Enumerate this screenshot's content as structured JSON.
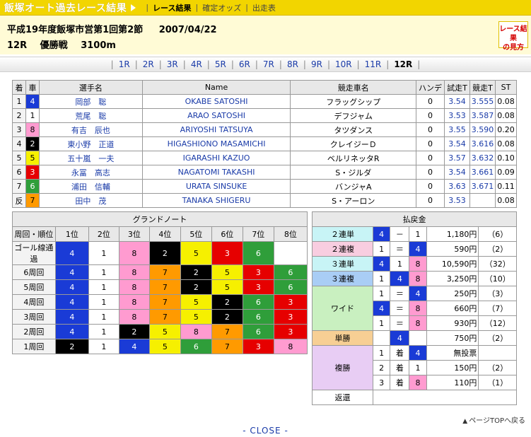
{
  "header": {
    "site_title": "飯塚オート過去レース結果",
    "nav": [
      {
        "label": "レース結果",
        "active": true
      },
      {
        "label": "確定オッズ",
        "active": false
      },
      {
        "label": "出走表",
        "active": false
      }
    ],
    "arrow_icon": "triangle-right-icon",
    "bar_color": "#f2d500"
  },
  "race_info": {
    "meeting": "平成19年度飯塚市営第1回第2節",
    "date": "2007/04/22",
    "race_no": "12R",
    "race_name": "優勝戦",
    "distance": "3100m",
    "guide_line1": "レース結果",
    "guide_line2": "の見方"
  },
  "race_tabs": {
    "items": [
      "1R",
      "2R",
      "3R",
      "4R",
      "5R",
      "6R",
      "7R",
      "8R",
      "9R",
      "10R",
      "11R",
      "12R"
    ],
    "current": "12R"
  },
  "results": {
    "headers": [
      "着",
      "車",
      "選手名",
      "Name",
      "競走車名",
      "ハンデ",
      "試走T",
      "競走T",
      "ST"
    ],
    "rows": [
      {
        "rank": "1",
        "car": "4",
        "name": "岡部　聡",
        "roman": "OKABE SATOSHI",
        "machine": "フラッグシップ",
        "handicap": "0",
        "trial": "3.54",
        "race_time": "3.555",
        "st": "0.08"
      },
      {
        "rank": "2",
        "car": "1",
        "name": "荒尾　聡",
        "roman": "ARAO SATOSHI",
        "machine": "デフジャム",
        "handicap": "0",
        "trial": "3.53",
        "race_time": "3.587",
        "st": "0.08"
      },
      {
        "rank": "3",
        "car": "8",
        "name": "有吉　辰也",
        "roman": "ARIYOSHI TATSUYA",
        "machine": "タツダンス",
        "handicap": "0",
        "trial": "3.55",
        "race_time": "3.590",
        "st": "0.20"
      },
      {
        "rank": "4",
        "car": "2",
        "name": "東小野　正道",
        "roman": "HIGASHIONO MASAMICHI",
        "machine": "クレイジーＤ",
        "handicap": "0",
        "trial": "3.54",
        "race_time": "3.616",
        "st": "0.08"
      },
      {
        "rank": "5",
        "car": "5",
        "name": "五十嵐　一夫",
        "roman": "IGARASHI KAZUO",
        "machine": "ベルリネッタR",
        "handicap": "0",
        "trial": "3.57",
        "race_time": "3.632",
        "st": "0.10"
      },
      {
        "rank": "6",
        "car": "3",
        "name": "永冨　高志",
        "roman": "NAGATOMI TAKASHI",
        "machine": "S・ジルダ",
        "handicap": "0",
        "trial": "3.54",
        "race_time": "3.661",
        "st": "0.09"
      },
      {
        "rank": "7",
        "car": "6",
        "name": "浦田　信輔",
        "roman": "URATA SINSUKE",
        "machine": "バンジャA",
        "handicap": "0",
        "trial": "3.63",
        "race_time": "3.671",
        "st": "0.11"
      },
      {
        "rank": "反",
        "car": "7",
        "name": "田中　茂",
        "roman": "TANAKA SHIGERU",
        "machine": "S・アーロン",
        "handicap": "0",
        "trial": "3.53",
        "race_time": "",
        "st": "0.08"
      }
    ]
  },
  "grand_note": {
    "title": "グランドノート",
    "headers": [
      "周回・順位",
      "1位",
      "2位",
      "3位",
      "4位",
      "5位",
      "6位",
      "7位",
      "8位"
    ],
    "rows": [
      {
        "lap": "ゴール線通過",
        "cars": [
          "4",
          "1",
          "8",
          "2",
          "5",
          "3",
          "6",
          ""
        ]
      },
      {
        "lap": "6周回",
        "cars": [
          "4",
          "1",
          "8",
          "7",
          "2",
          "5",
          "3",
          "6"
        ]
      },
      {
        "lap": "5周回",
        "cars": [
          "4",
          "1",
          "8",
          "7",
          "2",
          "5",
          "3",
          "6"
        ]
      },
      {
        "lap": "4周回",
        "cars": [
          "4",
          "1",
          "8",
          "7",
          "5",
          "2",
          "6",
          "3"
        ]
      },
      {
        "lap": "3周回",
        "cars": [
          "4",
          "1",
          "8",
          "7",
          "5",
          "2",
          "6",
          "3"
        ]
      },
      {
        "lap": "2周回",
        "cars": [
          "4",
          "1",
          "2",
          "5",
          "8",
          "7",
          "6",
          "3"
        ]
      },
      {
        "lap": "1周回",
        "cars": [
          "2",
          "1",
          "4",
          "5",
          "6",
          "7",
          "3",
          "8"
        ]
      }
    ]
  },
  "payouts": {
    "title": "払戻金",
    "rank_suffix": "着",
    "dash": "－",
    "equals": "＝",
    "rows": {
      "nirentan": {
        "label": "２連単",
        "c1": "4",
        "s1": "－",
        "c2": "1",
        "amount": "1,180円",
        "pop": "（6）"
      },
      "nirenfuku": {
        "label": "２連複",
        "c1": "1",
        "s1": "＝",
        "c2": "4",
        "amount": "590円",
        "pop": "（2）"
      },
      "sanrentan": {
        "label": "３連単",
        "c1": "4",
        "s1": "1",
        "c2": "8",
        "amount": "10,590円",
        "pop": "（32）"
      },
      "sanrenfuku": {
        "label": "３連複",
        "c1": "1",
        "s1": "4",
        "c2": "8",
        "amount": "3,250円",
        "pop": "（10）"
      },
      "wide_label": "ワイド",
      "wide": [
        {
          "c1": "1",
          "s1": "＝",
          "c2": "4",
          "amount": "250円",
          "pop": "（3）"
        },
        {
          "c1": "4",
          "s1": "＝",
          "c2": "8",
          "amount": "660円",
          "pop": "（7）"
        },
        {
          "c1": "1",
          "s1": "＝",
          "c2": "8",
          "amount": "930円",
          "pop": "（12）"
        }
      ],
      "tansho": {
        "label": "単勝",
        "car": "4",
        "amount": "750円",
        "pop": "（2）"
      },
      "fukusho_label": "複勝",
      "fukusho": [
        {
          "pos": "1",
          "car": "4",
          "amount": "無投票",
          "pop": ""
        },
        {
          "pos": "2",
          "car": "1",
          "amount": "150円",
          "pop": "（2）"
        },
        {
          "pos": "3",
          "car": "8",
          "amount": "110円",
          "pop": "（1）"
        }
      ],
      "henkan_label": "返還"
    }
  },
  "footer": {
    "page_top": "ページTOPへ戻る",
    "page_top_icon": "triangle-up-icon",
    "close": "- CLOSE -"
  }
}
